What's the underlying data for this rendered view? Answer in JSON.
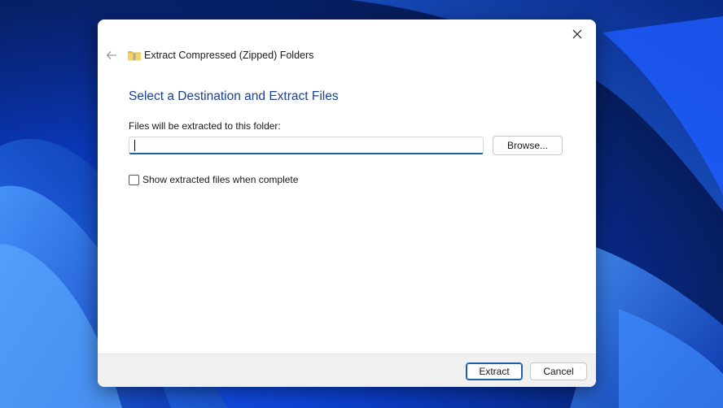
{
  "dialog": {
    "title": "Extract Compressed (Zipped) Folders",
    "heading": "Select a Destination and Extract Files",
    "field_label": "Files will be extracted to this folder:",
    "path_value": "",
    "browse_label": "Browse...",
    "checkbox_label": "Show extracted files when complete",
    "checkbox_checked": false,
    "extract_label": "Extract",
    "cancel_label": "Cancel"
  },
  "icons": {
    "close": "close-icon",
    "back": "back-arrow-icon",
    "folder": "zipped-folder-icon"
  },
  "colors": {
    "accent": "#1f5fa8",
    "heading": "#1c3f8f",
    "desktop_blue": "#0b3fcf"
  }
}
